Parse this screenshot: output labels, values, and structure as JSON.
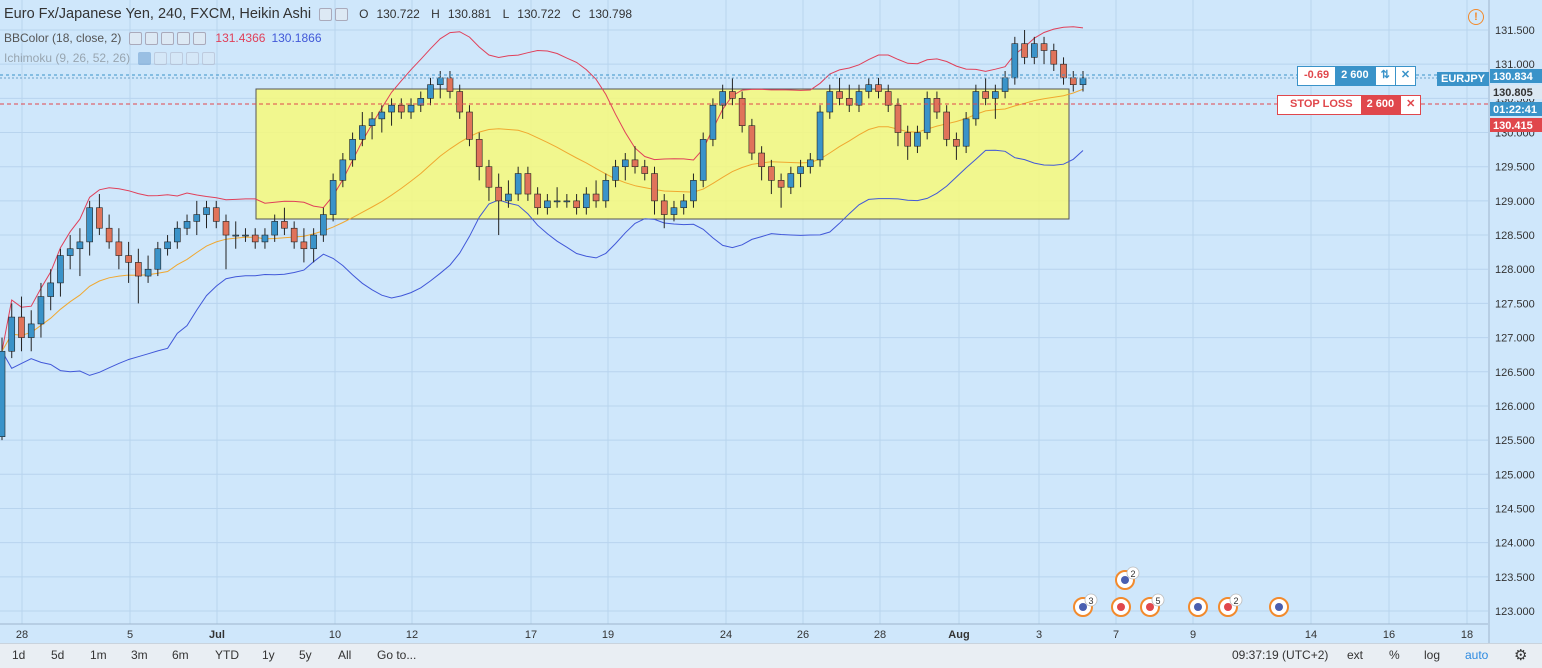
{
  "header": {
    "symbol_title": "Euro Fx/Japanese Yen, 240, FXCM, Heikin Ashi",
    "ohlc": {
      "o_label": "O",
      "o": "130.722",
      "h_label": "H",
      "h": "130.881",
      "l_label": "L",
      "l": "130.722",
      "c_label": "C",
      "c": "130.798"
    }
  },
  "indicators": [
    {
      "name": "BBColor (18, close, 2)",
      "v1": "131.4366",
      "v2": "130.1866"
    },
    {
      "name": "Ichimoku (9, 26, 52, 26)"
    }
  ],
  "price_axis": {
    "ticks": [
      "131.500",
      "131.000",
      "130.500",
      "130.000",
      "129.500",
      "129.000",
      "128.500",
      "128.000",
      "127.500",
      "127.000",
      "126.500",
      "126.000",
      "125.500",
      "125.000",
      "124.500",
      "124.000",
      "123.500",
      "123.000"
    ],
    "labels": {
      "current": "130.834",
      "symbol": "EURJPY",
      "entry": "130.805",
      "countdown": "01:22:41",
      "stop": "130.415"
    }
  },
  "trade": {
    "pnl": "-0.69",
    "qty": "2 600",
    "stop_label": "STOP LOSS",
    "stop_qty": "2 600",
    "swap_icon": "⇅",
    "close_icon": "✕"
  },
  "time_axis": [
    "28",
    "5",
    "Jul",
    "10",
    "12",
    "17",
    "19",
    "24",
    "26",
    "28",
    "Aug",
    "3",
    "7",
    "9",
    "14",
    "16",
    "18"
  ],
  "events": [
    {
      "x": 1083,
      "count": "3"
    },
    {
      "x": 1121,
      "count": ""
    },
    {
      "x": 1125,
      "count": "2"
    },
    {
      "x": 1150,
      "count": "5"
    },
    {
      "x": 1198,
      "count": ""
    },
    {
      "x": 1228,
      "count": "2"
    },
    {
      "x": 1279,
      "count": ""
    }
  ],
  "bottom": {
    "ranges": [
      "1d",
      "5d",
      "1m",
      "3m",
      "6m",
      "YTD",
      "1y",
      "5y",
      "All"
    ],
    "goto": "Go to...",
    "time": "09:37:19 (UTC+2)",
    "opts": [
      "ext",
      "%",
      "log",
      "auto"
    ],
    "settings_icon": "gear-icon"
  },
  "colors": {
    "up": "#3a93c9",
    "down": "#e0735a",
    "box": "#f7f97a",
    "bb_upper": "#e0405a",
    "bb_lower": "#4158d8",
    "bb_mid": "#f0a830",
    "ichi": "#999999",
    "stop": "#e0474c",
    "bg": "#cfe7fb"
  },
  "chart_data": {
    "type": "candlestick",
    "x_range": [
      "Jun 26",
      "Aug 19"
    ],
    "ylim": [
      123.0,
      131.7
    ],
    "y_ticks": [
      123.0,
      123.5,
      124.0,
      124.5,
      125.0,
      125.5,
      126.0,
      126.5,
      127.0,
      127.5,
      128.0,
      128.5,
      129.0,
      129.5,
      130.0,
      130.5,
      131.0,
      131.5
    ],
    "candles_ohlc": [
      [
        125.55,
        127.0,
        125.5,
        126.8
      ],
      [
        126.8,
        127.5,
        126.7,
        127.3
      ],
      [
        127.3,
        127.6,
        126.8,
        127.0
      ],
      [
        127.0,
        127.4,
        126.8,
        127.2
      ],
      [
        127.2,
        127.8,
        127.0,
        127.6
      ],
      [
        127.6,
        128.0,
        127.4,
        127.8
      ],
      [
        127.8,
        128.3,
        127.6,
        128.2
      ],
      [
        128.2,
        128.5,
        128.0,
        128.3
      ],
      [
        128.3,
        128.6,
        127.9,
        128.4
      ],
      [
        128.4,
        129.0,
        128.2,
        128.9
      ],
      [
        128.9,
        129.1,
        128.5,
        128.6
      ],
      [
        128.6,
        128.8,
        128.3,
        128.4
      ],
      [
        128.4,
        128.6,
        128.0,
        128.2
      ],
      [
        128.2,
        128.4,
        127.8,
        128.1
      ],
      [
        128.1,
        128.3,
        127.5,
        127.9
      ],
      [
        127.9,
        128.2,
        127.8,
        128.0
      ],
      [
        128.0,
        128.4,
        127.9,
        128.3
      ],
      [
        128.3,
        128.5,
        128.2,
        128.4
      ],
      [
        128.4,
        128.7,
        128.3,
        128.6
      ],
      [
        128.6,
        128.8,
        128.5,
        128.7
      ],
      [
        128.7,
        129.0,
        128.5,
        128.8
      ],
      [
        128.8,
        129.0,
        128.6,
        128.9
      ],
      [
        128.9,
        129.0,
        128.6,
        128.7
      ],
      [
        128.7,
        128.8,
        128.0,
        128.5
      ],
      [
        128.5,
        128.7,
        128.3,
        128.5
      ],
      [
        128.5,
        128.6,
        128.4,
        128.5
      ],
      [
        128.5,
        128.6,
        128.3,
        128.4
      ],
      [
        128.4,
        128.6,
        128.3,
        128.5
      ],
      [
        128.5,
        128.8,
        128.4,
        128.7
      ],
      [
        128.7,
        128.9,
        128.5,
        128.6
      ],
      [
        128.6,
        128.7,
        128.3,
        128.4
      ],
      [
        128.4,
        128.6,
        128.1,
        128.3
      ],
      [
        128.3,
        128.6,
        128.1,
        128.5
      ],
      [
        128.5,
        128.9,
        128.4,
        128.8
      ],
      [
        128.8,
        129.4,
        128.7,
        129.3
      ],
      [
        129.3,
        129.7,
        129.2,
        129.6
      ],
      [
        129.6,
        130.0,
        129.5,
        129.9
      ],
      [
        129.9,
        130.3,
        129.8,
        130.1
      ],
      [
        130.1,
        130.3,
        129.9,
        130.2
      ],
      [
        130.2,
        130.4,
        130.0,
        130.3
      ],
      [
        130.3,
        130.5,
        130.1,
        130.4
      ],
      [
        130.4,
        130.5,
        130.2,
        130.3
      ],
      [
        130.3,
        130.5,
        130.2,
        130.4
      ],
      [
        130.4,
        130.6,
        130.3,
        130.5
      ],
      [
        130.5,
        130.8,
        130.4,
        130.7
      ],
      [
        130.7,
        130.9,
        130.5,
        130.8
      ],
      [
        130.8,
        130.9,
        130.5,
        130.6
      ],
      [
        130.6,
        130.7,
        130.2,
        130.3
      ],
      [
        130.3,
        130.4,
        129.8,
        129.9
      ],
      [
        129.9,
        130.0,
        129.3,
        129.5
      ],
      [
        129.5,
        129.6,
        129.0,
        129.2
      ],
      [
        129.2,
        129.4,
        128.5,
        129.0
      ],
      [
        129.0,
        129.3,
        128.9,
        129.1
      ],
      [
        129.1,
        129.5,
        129.0,
        129.4
      ],
      [
        129.4,
        129.5,
        129.0,
        129.1
      ],
      [
        129.1,
        129.2,
        128.8,
        128.9
      ],
      [
        128.9,
        129.1,
        128.8,
        129.0
      ],
      [
        129.0,
        129.2,
        128.9,
        129.0
      ],
      [
        129.0,
        129.1,
        128.9,
        129.0
      ],
      [
        129.0,
        129.1,
        128.8,
        128.9
      ],
      [
        128.9,
        129.2,
        128.8,
        129.1
      ],
      [
        129.1,
        129.3,
        128.9,
        129.0
      ],
      [
        129.0,
        129.4,
        128.9,
        129.3
      ],
      [
        129.3,
        129.6,
        129.2,
        129.5
      ],
      [
        129.5,
        129.7,
        129.3,
        129.6
      ],
      [
        129.6,
        129.8,
        129.4,
        129.5
      ],
      [
        129.5,
        129.6,
        129.3,
        129.4
      ],
      [
        129.4,
        129.5,
        128.8,
        129.0
      ],
      [
        129.0,
        129.1,
        128.6,
        128.8
      ],
      [
        128.8,
        129.0,
        128.7,
        128.9
      ],
      [
        128.9,
        129.1,
        128.8,
        129.0
      ],
      [
        129.0,
        129.4,
        128.9,
        129.3
      ],
      [
        129.3,
        130.0,
        129.2,
        129.9
      ],
      [
        129.9,
        130.5,
        129.8,
        130.4
      ],
      [
        130.4,
        130.7,
        130.2,
        130.6
      ],
      [
        130.6,
        130.8,
        130.4,
        130.5
      ],
      [
        130.5,
        130.6,
        130.0,
        130.1
      ],
      [
        130.1,
        130.2,
        129.6,
        129.7
      ],
      [
        129.7,
        129.8,
        129.3,
        129.5
      ],
      [
        129.5,
        129.6,
        129.1,
        129.3
      ],
      [
        129.3,
        129.4,
        128.9,
        129.2
      ],
      [
        129.2,
        129.5,
        129.1,
        129.4
      ],
      [
        129.4,
        129.6,
        129.2,
        129.5
      ],
      [
        129.5,
        129.7,
        129.4,
        129.6
      ],
      [
        129.6,
        130.4,
        129.5,
        130.3
      ],
      [
        130.3,
        130.7,
        130.2,
        130.6
      ],
      [
        130.6,
        130.8,
        130.4,
        130.5
      ],
      [
        130.5,
        130.7,
        130.3,
        130.4
      ],
      [
        130.4,
        130.7,
        130.3,
        130.6
      ],
      [
        130.6,
        130.8,
        130.5,
        130.7
      ],
      [
        130.7,
        130.8,
        130.5,
        130.6
      ],
      [
        130.6,
        130.7,
        130.3,
        130.4
      ],
      [
        130.4,
        130.5,
        129.8,
        130.0
      ],
      [
        130.0,
        130.1,
        129.6,
        129.8
      ],
      [
        129.8,
        130.1,
        129.7,
        130.0
      ],
      [
        130.0,
        130.6,
        129.9,
        130.5
      ],
      [
        130.5,
        130.6,
        130.2,
        130.3
      ],
      [
        130.3,
        130.4,
        129.8,
        129.9
      ],
      [
        129.9,
        130.0,
        129.6,
        129.8
      ],
      [
        129.8,
        130.3,
        129.7,
        130.2
      ],
      [
        130.2,
        130.7,
        130.1,
        130.6
      ],
      [
        130.6,
        130.8,
        130.4,
        130.5
      ],
      [
        130.5,
        130.7,
        130.2,
        130.6
      ],
      [
        130.6,
        130.9,
        130.5,
        130.8
      ],
      [
        130.8,
        131.4,
        130.7,
        131.3
      ],
      [
        131.3,
        131.5,
        131.0,
        131.1
      ],
      [
        131.1,
        131.4,
        131.0,
        131.3
      ],
      [
        131.3,
        131.4,
        131.0,
        131.2
      ],
      [
        131.2,
        131.3,
        130.9,
        131.0
      ],
      [
        131.0,
        131.1,
        130.7,
        130.8
      ],
      [
        130.8,
        130.9,
        130.6,
        130.7
      ],
      [
        130.7,
        130.9,
        130.6,
        130.8
      ]
    ]
  }
}
